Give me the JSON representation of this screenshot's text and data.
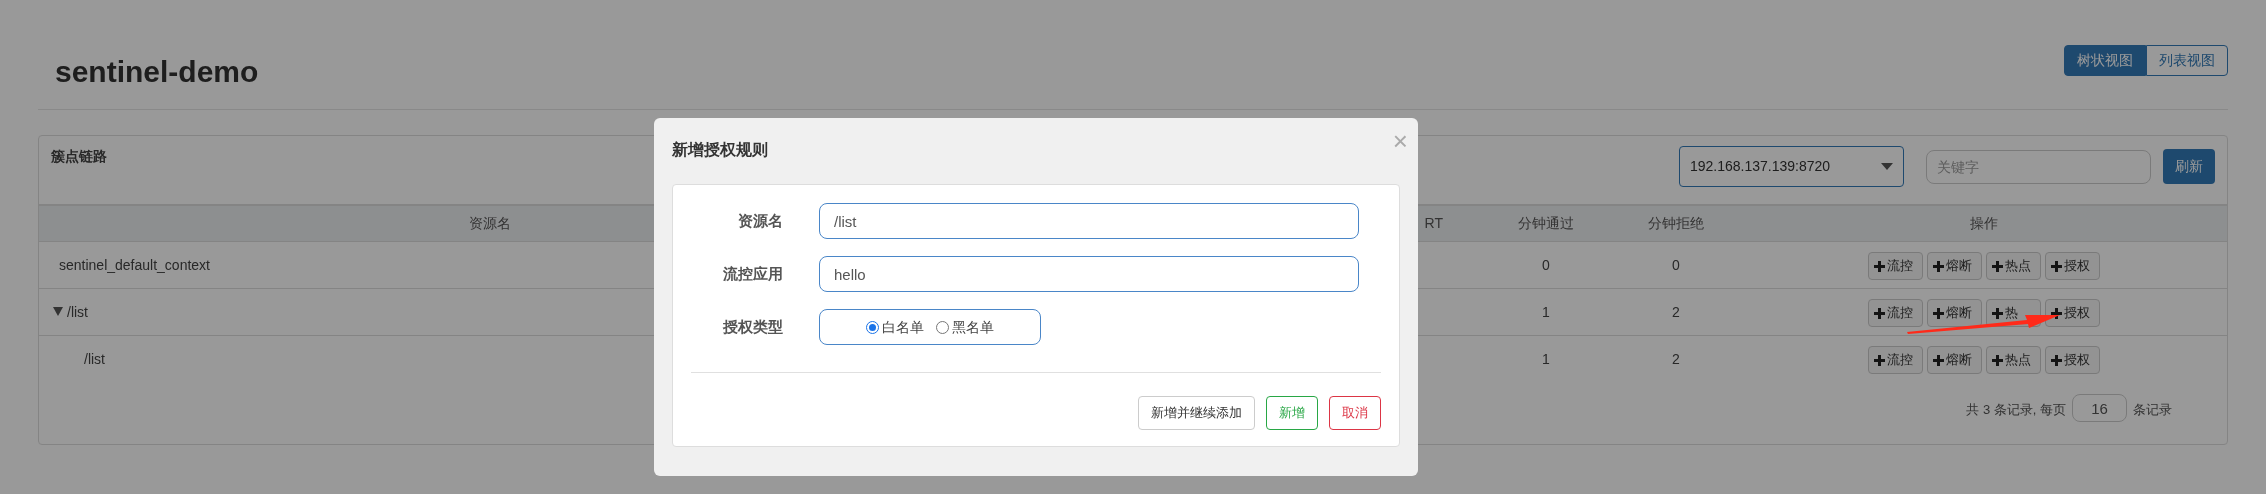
{
  "header": {
    "title": "sentinel-demo",
    "views": [
      {
        "label": "树状视图",
        "selected": true
      },
      {
        "label": "列表视图",
        "selected": false
      }
    ]
  },
  "panel": {
    "title": "簇点链路",
    "machine": "192.168.137.139:8720",
    "keyword_placeholder": "关键字",
    "refresh": "刷新"
  },
  "table": {
    "columns": [
      "资源名",
      "RT",
      "分钟通过",
      "分钟拒绝",
      "操作"
    ],
    "rows": [
      {
        "name": "sentinel_default_context",
        "pass": "0",
        "block": "0",
        "actions": [
          "流控",
          "熔断",
          "热点",
          "授权"
        ]
      },
      {
        "name": "/list",
        "expanded": true,
        "pass": "1",
        "block": "2",
        "actions": [
          "流控",
          "熔断",
          "热",
          "授权"
        ],
        "children": [
          {
            "name": "/list",
            "pass": "1",
            "block": "2",
            "actions": [
              "流控",
              "熔断",
              "热点",
              "授权"
            ]
          }
        ]
      }
    ]
  },
  "pager": {
    "prefix": "共 3 条记录, 每页",
    "page_size": "16",
    "suffix": "条记录"
  },
  "dialog": {
    "title": "新增授权规则",
    "close": "×",
    "fields": [
      {
        "label": "资源名",
        "value": "/list"
      },
      {
        "label": "流控应用",
        "value": "hello"
      }
    ],
    "auth_type": {
      "label": "授权类型",
      "options": [
        {
          "label": "白名单",
          "selected": true
        },
        {
          "label": "黑名单",
          "selected": false
        }
      ]
    },
    "buttons": [
      {
        "label": "新增并继续添加",
        "kind": "default"
      },
      {
        "label": "新增",
        "kind": "success"
      },
      {
        "label": "取消",
        "kind": "danger"
      }
    ]
  }
}
